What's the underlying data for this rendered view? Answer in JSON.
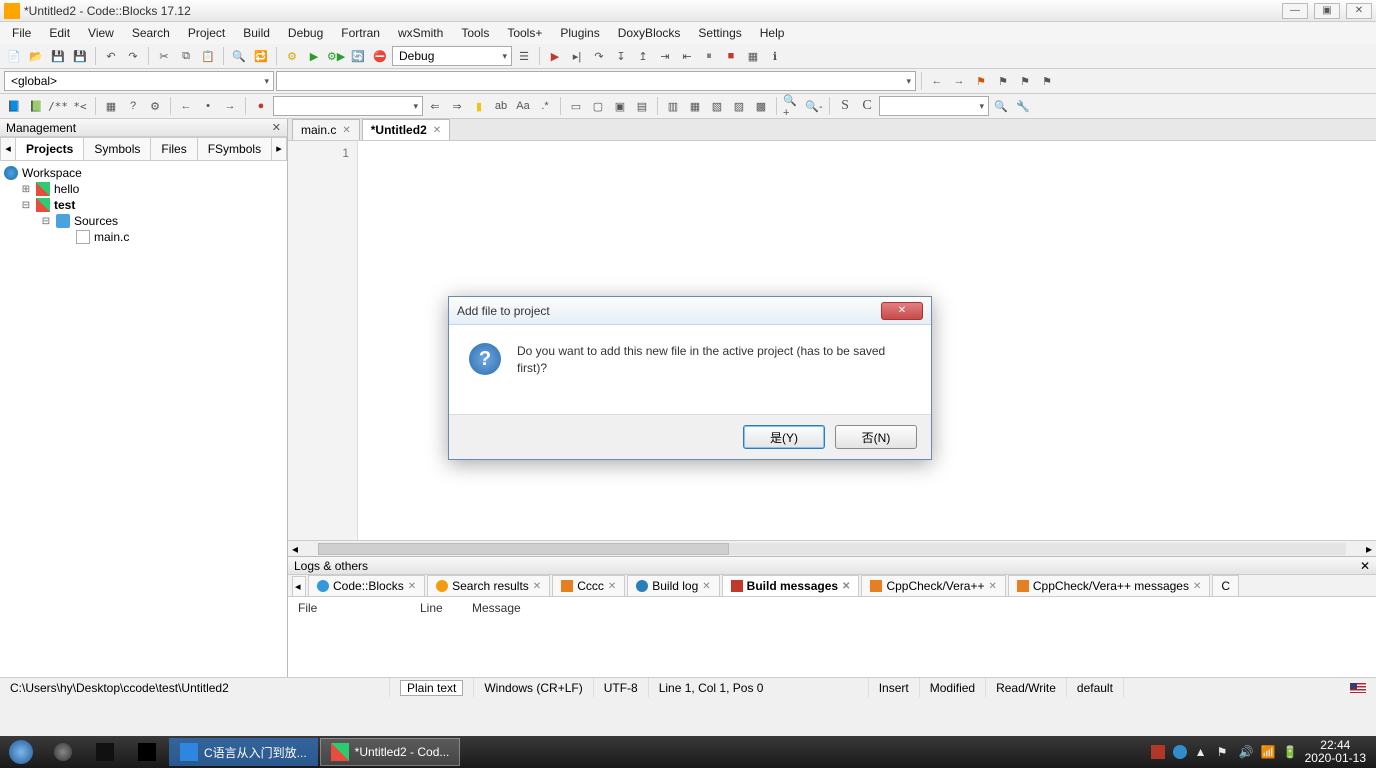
{
  "window": {
    "title": "*Untitled2 - Code::Blocks 17.12"
  },
  "menus": [
    "File",
    "Edit",
    "View",
    "Search",
    "Project",
    "Build",
    "Debug",
    "Fortran",
    "wxSmith",
    "Tools",
    "Tools+",
    "Plugins",
    "DoxyBlocks",
    "Settings",
    "Help"
  ],
  "toolbar": {
    "target_dropdown": "Debug",
    "scope_dropdown": "<global>"
  },
  "management": {
    "title": "Management",
    "tabs": [
      "Projects",
      "Symbols",
      "Files",
      "FSymbols"
    ],
    "active_tab": "Projects",
    "tree": {
      "root": "Workspace",
      "projects": [
        {
          "name": "hello",
          "bold": false,
          "children": []
        },
        {
          "name": "test",
          "bold": true,
          "children": [
            {
              "name": "Sources",
              "type": "folder",
              "children": [
                {
                  "name": "main.c",
                  "type": "file"
                }
              ]
            }
          ]
        }
      ]
    }
  },
  "editor": {
    "tabs": [
      {
        "label": "main.c",
        "active": false
      },
      {
        "label": "*Untitled2",
        "active": true
      }
    ],
    "line_number": "1"
  },
  "dialog": {
    "title": "Add file to project",
    "message": "Do you want to add this new file in the active project (has to be saved first)?",
    "yes": "是(Y)",
    "no": "否(N)"
  },
  "logs": {
    "title": "Logs & others",
    "tabs": [
      "Code::Blocks",
      "Search results",
      "Cccc",
      "Build log",
      "Build messages",
      "CppCheck/Vera++",
      "CppCheck/Vera++ messages",
      "C"
    ],
    "active_tab": "Build messages",
    "columns": [
      "File",
      "Line",
      "Message"
    ]
  },
  "status": {
    "path": "C:\\Users\\hy\\Desktop\\ccode\\test\\Untitled2",
    "filetype": "Plain text",
    "eol": "Windows (CR+LF)",
    "encoding": "UTF-8",
    "position": "Line 1, Col 1, Pos 0",
    "insert": "Insert",
    "modified": "Modified",
    "rw": "Read/Write",
    "profile": "default"
  },
  "taskbar": {
    "items": [
      {
        "label": "",
        "icon": "gear"
      },
      {
        "label": "",
        "icon": "nox"
      },
      {
        "label": "",
        "icon": "terminal"
      },
      {
        "label": "C语言从入门到放...",
        "icon": "wps",
        "active": false
      },
      {
        "label": "*Untitled2 - Cod...",
        "icon": "cb",
        "active": true
      }
    ],
    "clock_time": "22:44",
    "clock_date": "2020-01-13"
  }
}
